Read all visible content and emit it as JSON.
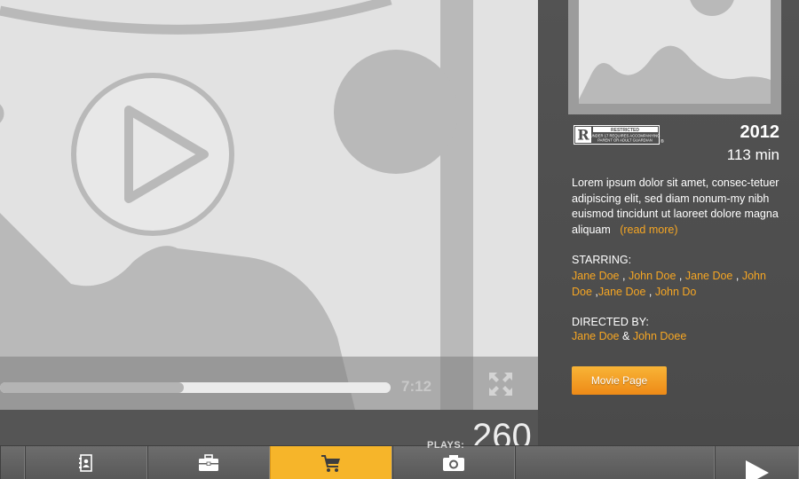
{
  "player": {
    "time": "7:12",
    "progress": 0.47
  },
  "movie": {
    "rating_badge": {
      "letter": "R",
      "title": "RESTRICTED",
      "line1": "UNDER 17 REQUIRES ACCOMPANYING",
      "line2": "PARENT OR ADULT GUARDIAN"
    },
    "year": "2012",
    "runtime": "113 min",
    "synopsis": "Lorem ipsum dolor sit amet, consec-tetuer adipiscing elit, sed diam nonum-my nibh euismod tincidunt ut laoreet dolore magna aliquam",
    "read_more": "(read more)",
    "starring_heading": "STARRING:",
    "starring": [
      "Jane Doe",
      "John Doe",
      "Jane Doe",
      "John Doe",
      "Jane Doe",
      "John Do"
    ],
    "directed_heading": "DIRECTED BY:",
    "directors": [
      "Jane Doe",
      "John Doee"
    ],
    "directors_sep": "&",
    "movie_page_label": "Movie Page"
  },
  "stats": {
    "plays_label": "PLAYS:",
    "plays_count": "260"
  },
  "tabs": [
    {
      "name": "contacts-icon"
    },
    {
      "name": "briefcase-icon"
    },
    {
      "name": "cart-icon",
      "active": true
    },
    {
      "name": "camera-icon"
    },
    {
      "name": "empty"
    },
    {
      "name": "play-icon"
    }
  ],
  "colors": {
    "accent": "#F6A623",
    "active_tab": "#F6B52A",
    "sidebar": "#4E4E4E",
    "placeholder": "#E2E2E2"
  }
}
